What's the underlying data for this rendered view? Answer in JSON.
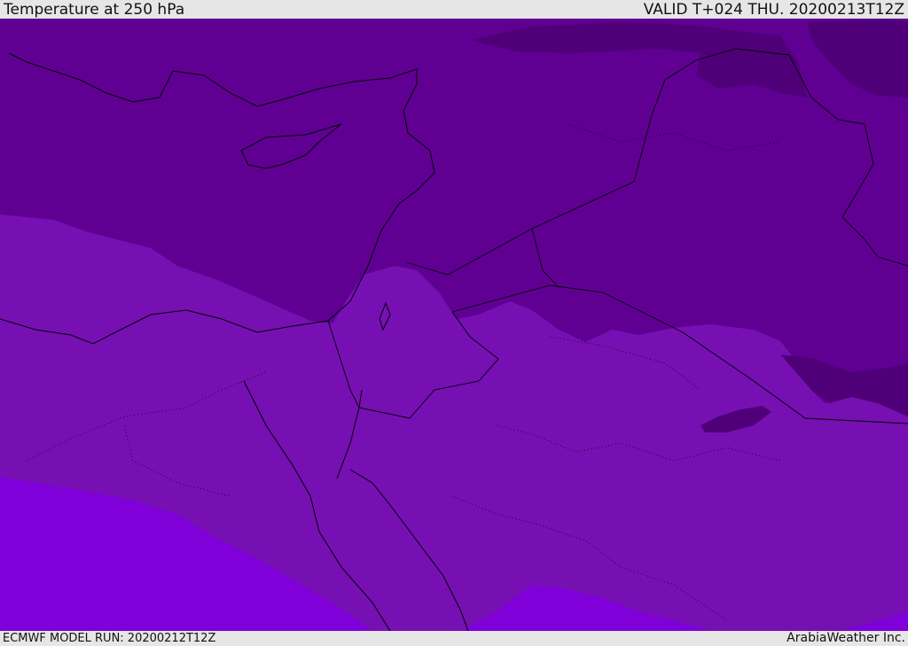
{
  "header": {
    "title": "Temperature at 250 hPa",
    "valid": "VALID T+024 THU. 20200213T12Z"
  },
  "footer": {
    "model_run": "ECMWF MODEL RUN: 20200212T12Z",
    "brand": "ArabiaWeather Inc."
  },
  "colors": {
    "band_coldest": "#4f0079",
    "band_cold": "#5f0093",
    "band_mid": "#7610b3",
    "band_warm": "#7f00d9",
    "coastline": "#000000",
    "background": "#e6e6e6"
  }
}
